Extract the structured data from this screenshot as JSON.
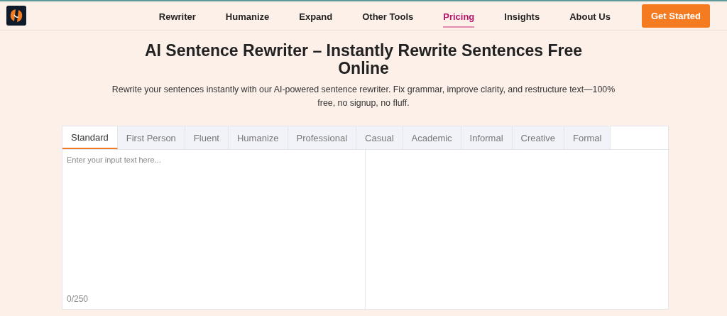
{
  "nav": {
    "items": [
      {
        "label": "Rewriter",
        "selected": false
      },
      {
        "label": "Humanize",
        "selected": false
      },
      {
        "label": "Expand",
        "selected": false
      },
      {
        "label": "Other Tools",
        "selected": false
      },
      {
        "label": "Pricing",
        "selected": true
      },
      {
        "label": "Insights",
        "selected": false
      },
      {
        "label": "About Us",
        "selected": false
      }
    ],
    "cta": "Get Started"
  },
  "hero": {
    "title": "AI Sentence Rewriter – Instantly Rewrite Sentences Free Online",
    "subtitle": "Rewrite your sentences instantly with our AI-powered sentence rewriter. Fix grammar, improve clarity, and restructure text—100% free, no signup, no fluff."
  },
  "tabs": [
    {
      "label": "Standard",
      "selected": true
    },
    {
      "label": "First Person",
      "selected": false
    },
    {
      "label": "Fluent",
      "selected": false
    },
    {
      "label": "Humanize",
      "selected": false
    },
    {
      "label": "Professional",
      "selected": false
    },
    {
      "label": "Casual",
      "selected": false
    },
    {
      "label": "Academic",
      "selected": false
    },
    {
      "label": "Informal",
      "selected": false
    },
    {
      "label": "Creative",
      "selected": false
    },
    {
      "label": "Formal",
      "selected": false
    }
  ],
  "input": {
    "placeholder": "Enter your input text here...",
    "counter": "0/250"
  }
}
